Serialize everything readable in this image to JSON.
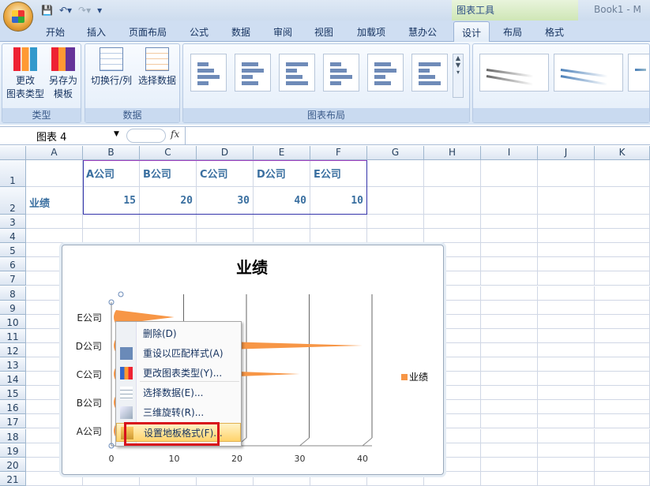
{
  "titlebar": {
    "contextual_tab_group": "图表工具",
    "book_title": "Book1 - M"
  },
  "tabs": [
    {
      "label": "开始"
    },
    {
      "label": "插入"
    },
    {
      "label": "页面布局"
    },
    {
      "label": "公式"
    },
    {
      "label": "数据"
    },
    {
      "label": "审阅"
    },
    {
      "label": "视图"
    },
    {
      "label": "加载项"
    },
    {
      "label": "慧办公"
    },
    {
      "label": "设计",
      "active": true
    },
    {
      "label": "布局"
    },
    {
      "label": "格式"
    }
  ],
  "ribbon": {
    "type_group": {
      "label": "类型",
      "change_type": "更改\n图表类型",
      "save_template": "另存为\n模板"
    },
    "data_group": {
      "label": "数据",
      "switch_row_col": "切换行/列",
      "select_data": "选择数据"
    },
    "layout_group": {
      "label": "图表布局"
    }
  },
  "formula_bar": {
    "name_box": "图表 4",
    "fx": "fx",
    "value": ""
  },
  "sheet": {
    "columns": [
      "A",
      "B",
      "C",
      "D",
      "E",
      "F",
      "G",
      "H",
      "I",
      "J",
      "K"
    ],
    "rows": [
      "1",
      "2",
      "3",
      "4",
      "5",
      "6",
      "7",
      "8",
      "9",
      "10",
      "11",
      "12",
      "13",
      "14",
      "15",
      "16",
      "17",
      "18",
      "19",
      "20",
      "21"
    ],
    "header_row": [
      "",
      "A公司",
      "B公司",
      "C公司",
      "D公司",
      "E公司"
    ],
    "data_row": [
      "业绩",
      "15",
      "20",
      "30",
      "40",
      "10"
    ]
  },
  "chart_data": {
    "type": "bar",
    "subtype": "3d-cone-horizontal",
    "title": "业绩",
    "categories": [
      "A公司",
      "B公司",
      "C公司",
      "D公司",
      "E公司"
    ],
    "series": [
      {
        "name": "业绩",
        "values": [
          15,
          20,
          30,
          40,
          10
        ],
        "color": "#f79646"
      }
    ],
    "xticks": [
      "0",
      "10",
      "20",
      "30",
      "40"
    ],
    "xlim": [
      0,
      40
    ],
    "grid": true,
    "legend": "right"
  },
  "context_menu": [
    {
      "label": "删除(D)",
      "icon": ""
    },
    {
      "label": "重设以匹配样式(A)",
      "icon": "reset-style-icon"
    },
    {
      "label": "更改图表类型(Y)...",
      "icon": "chart-type-icon"
    },
    {
      "label": "选择数据(E)...",
      "icon": "select-data-icon"
    },
    {
      "label": "三维旋转(R)...",
      "icon": "3d-rotation-icon"
    },
    {
      "label": "设置地板格式(F)...",
      "icon": "format-floor-icon",
      "highlighted": true
    }
  ],
  "colors": {
    "accent": "#f79646",
    "highlight_box": "#d8111b"
  }
}
